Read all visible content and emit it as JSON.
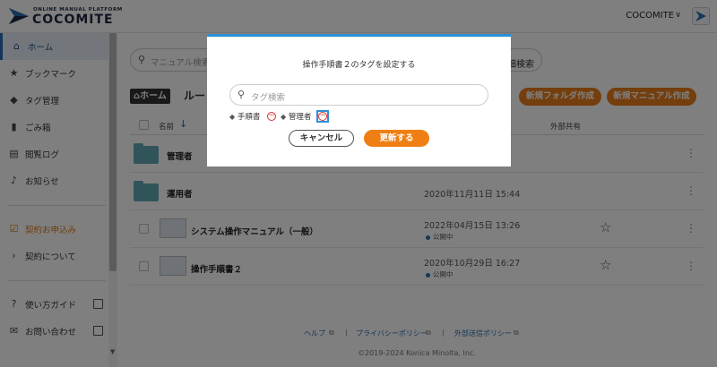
{
  "header": {
    "logo_sub": "ONLINE MANUAL PLATFORM",
    "logo_main": "COCOMITE",
    "account": "COCOMITE",
    "account_arrow": "∨"
  },
  "sidebar": {
    "items": [
      {
        "label": "ホーム",
        "icon": "home-icon"
      },
      {
        "label": "ブックマーク",
        "icon": "star-icon"
      },
      {
        "label": "タグ管理",
        "icon": "tag-icon"
      },
      {
        "label": "ごみ箱",
        "icon": "trash-icon"
      },
      {
        "label": "閲覧ログ",
        "icon": "document-icon"
      },
      {
        "label": "お知らせ",
        "icon": "bell-icon"
      },
      {
        "label": "契約お申込み",
        "icon": "checkbox-icon"
      },
      {
        "label": "契約について",
        "icon": "chevron-right-icon"
      },
      {
        "label": "使い方ガイド",
        "icon": "question-icon"
      },
      {
        "label": "お問い合わせ",
        "icon": "mail-icon"
      }
    ]
  },
  "main": {
    "search_placeholder": "マニュアル検索",
    "detail_search": "詳細検索",
    "home_badge": "ホーム",
    "route_label": "ルート",
    "new_folder": "新規フォルダ作成",
    "new_manual": "新規マニュアル作成",
    "col_name": "名前",
    "col_share": "外部共有",
    "rows": [
      {
        "name": "管理者",
        "date": "",
        "status": ""
      },
      {
        "name": "運用者",
        "date": "2020年11月11日 15:44",
        "status": ""
      },
      {
        "name": "システム操作マニュアル（一般）",
        "date": "2022年04月15日 13:26",
        "status": "公開中"
      },
      {
        "name": "操作手順書２",
        "date": "2020年10月29日 16:27",
        "status": "公開中"
      }
    ]
  },
  "footer": {
    "help": "ヘルプ",
    "privacy": "プライバシーポリシー",
    "external": "外部送信ポリシー",
    "sep": "|",
    "copyright": "©2019-2024 Konica Minolta, Inc."
  },
  "modal": {
    "title": "操作手順書２のタグを設定する",
    "search_placeholder": "タグ検索",
    "tags": [
      "手順書",
      "管理者"
    ],
    "remove_glyph": "−",
    "cancel": "キャンセル",
    "update": "更新する"
  },
  "colors": {
    "accent": "#ef7f12",
    "highlight": "#2b8fd8"
  }
}
